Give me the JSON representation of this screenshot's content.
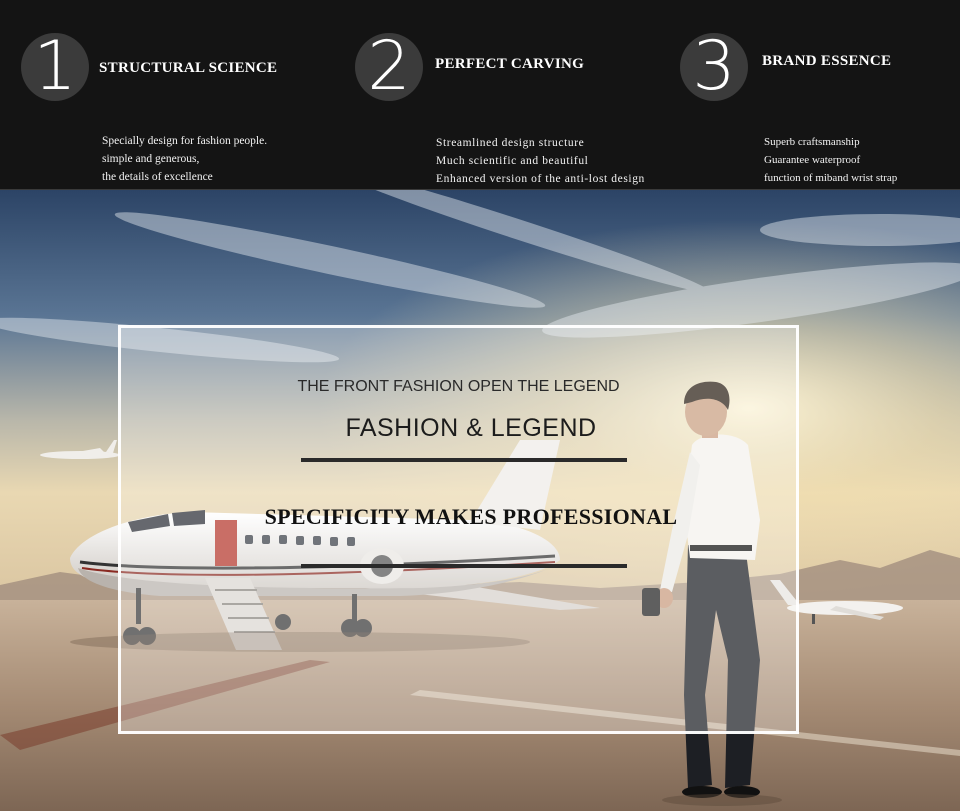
{
  "features": [
    {
      "number": "1",
      "title": "STRUCTURAL SCIENCE",
      "lines": [
        "Specially design for fashion people.",
        "simple and generous,",
        "the details of excellence"
      ]
    },
    {
      "number": "2",
      "title": "PERFECT CARVING",
      "lines": [
        "Streamlined design structure",
        "Much scientific and beautiful",
        "Enhanced version of the anti-lost design"
      ]
    },
    {
      "number": "3",
      "title": "BRAND ESSENCE",
      "lines": [
        "Superb craftsmanship",
        "Guarantee waterproof",
        "function of miband wrist strap"
      ]
    }
  ],
  "hero": {
    "tagline": "THE FRONT FASHION OPEN THE LEGEND",
    "headline": "FASHION & LEGEND",
    "slogan": "SPECIFICITY MAKES PROFESSIONAL"
  },
  "colors": {
    "band_background": "#141414",
    "number_circle": "#3b3b3b",
    "sky_top": "#2d4668",
    "sky_glow": "#f3e2b8",
    "tarmac": "#b39b85"
  }
}
